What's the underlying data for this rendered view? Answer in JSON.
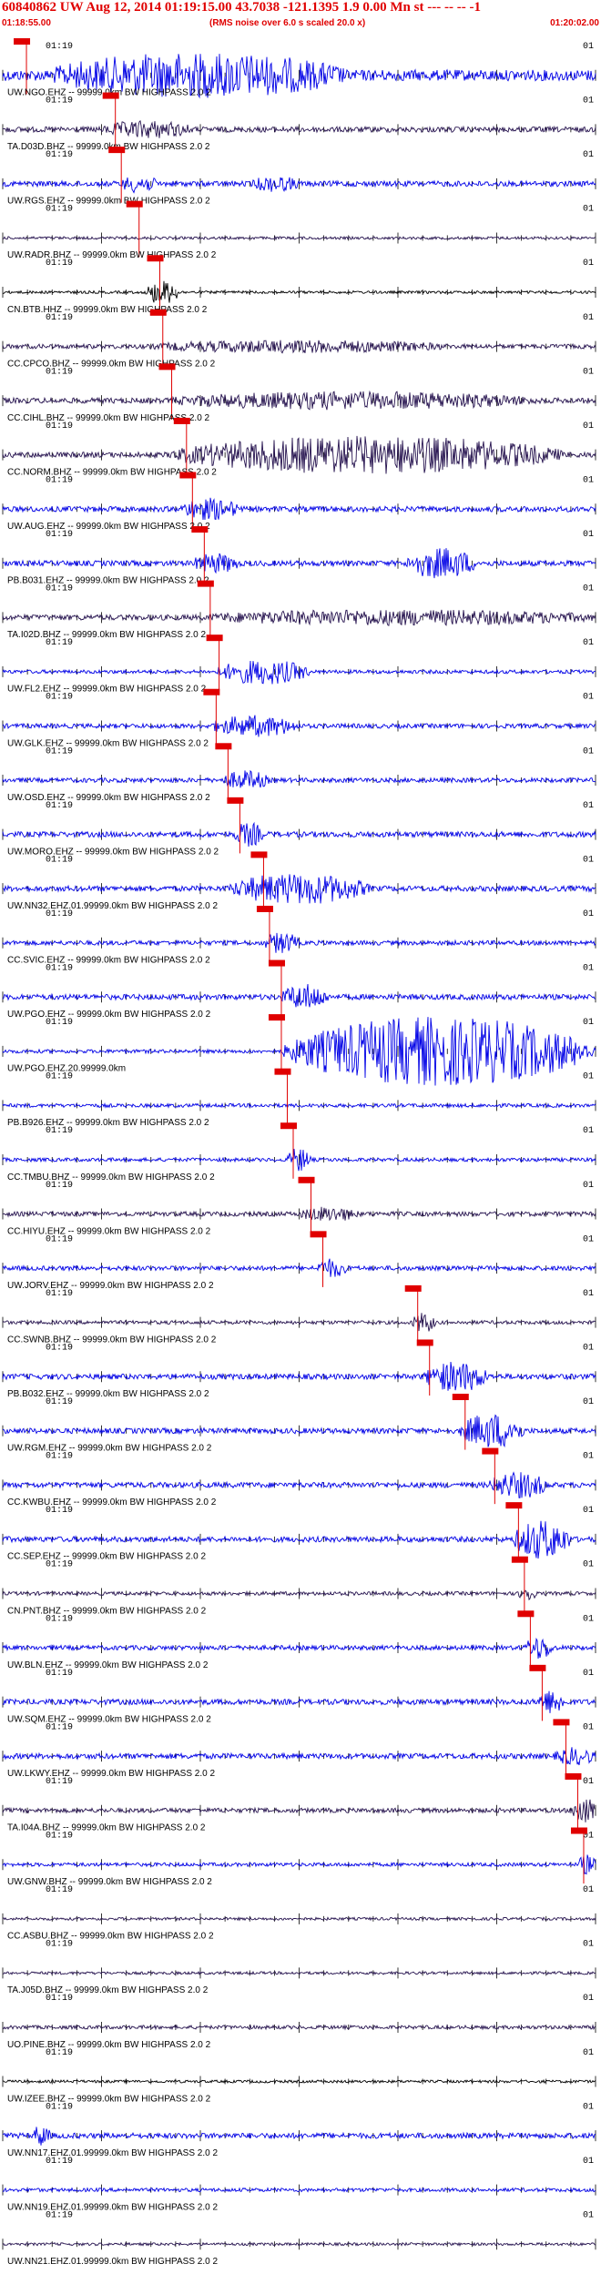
{
  "header": {
    "title": "60840862 UW Aug 12, 2014 01:19:15.00   43.7038 -121.1395  1.9 0.00 Mn st --- -- --  -1",
    "start_time": "01:18:55.00",
    "note": "(RMS noise over 6.0 s scaled 20.0 x)",
    "end_time": "01:20:02.00"
  },
  "colors": {
    "trace_blue": "#0000e6",
    "trace_navy": "#26134f",
    "trace_black": "#000000",
    "pick_red": "#e00000"
  },
  "chart_data": {
    "type": "line",
    "title": "60840862 UW Aug 12, 2014 01:19:15.00   43.7038 -121.1395  1.9 0.00 Mn st --- -- --  -1",
    "x_start": "01:18:55.00",
    "x_end": "01:20:02.00",
    "tick_minute_label": "01:19",
    "edge_label": "01",
    "pick_label": "P",
    "series": [
      {
        "name": "UW.NGO.EHZ -- 99999.0km BW  HIGHPASS  2.0  2",
        "color": "blue",
        "amp": 6,
        "pick": 0.04,
        "events": [
          [
            0.08,
            0.58,
            1.6
          ]
        ]
      },
      {
        "name": "TA.D03D.BHZ -- 99999.0km BW  HIGHPASS  2.0  2",
        "color": "navy",
        "amp": 3,
        "pick": 0.19,
        "events": [
          [
            0.17,
            0.32,
            0.6
          ]
        ]
      },
      {
        "name": "UW.RGS.EHZ -- 99999.0km BW  HIGHPASS  2.0  2",
        "color": "blue",
        "amp": 3,
        "pick": 0.2,
        "events": [
          [
            0.2,
            0.26,
            0.6
          ],
          [
            0.42,
            0.5,
            0.5
          ]
        ]
      },
      {
        "name": "UW.RADR.BHZ -- 99999.0km BW  HIGHPASS  2.0  2",
        "color": "navy",
        "amp": 1.5,
        "pick": 0.23,
        "events": []
      },
      {
        "name": "CN.BTB.HHZ -- 99999.0km BW  HIGHPASS  2.0  2",
        "color": "black",
        "amp": 1.5,
        "pick": 0.265,
        "events": [
          [
            0.24,
            0.3,
            1.0
          ]
        ]
      },
      {
        "name": "CC.CPCO.BHZ -- 99999.0km BW  HIGHPASS  2.0  2",
        "color": "navy",
        "amp": 2.5,
        "pick": 0.27,
        "events": [
          [
            0.25,
            0.75,
            0.4
          ]
        ]
      },
      {
        "name": "CC.CIHL.BHZ -- 99999.0km BW  HIGHPASS  2.0  2",
        "color": "navy",
        "amp": 3,
        "pick": 0.285,
        "events": [
          [
            0.28,
            0.9,
            0.6
          ]
        ]
      },
      {
        "name": "CC.NORM.BHZ -- 99999.0km BW  HIGHPASS  2.0  2",
        "color": "navy",
        "amp": 3,
        "pick": 0.31,
        "events": [
          [
            0.28,
            0.95,
            1.5
          ]
        ]
      },
      {
        "name": "UW.AUG.EHZ -- 99999.0km BW  HIGHPASS  2.0  2",
        "color": "blue",
        "amp": 3,
        "pick": 0.32,
        "events": [
          [
            0.3,
            0.4,
            0.8
          ]
        ]
      },
      {
        "name": "PB.B031.EHZ -- 99999.0km BW  HIGHPASS  2.0  2",
        "color": "blue",
        "amp": 3,
        "pick": 0.34,
        "events": [
          [
            0.32,
            0.4,
            0.7
          ],
          [
            0.68,
            0.8,
            1.2
          ]
        ]
      },
      {
        "name": "TA.I02D.BHZ -- 99999.0km BW  HIGHPASS  2.0  2",
        "color": "navy",
        "amp": 3,
        "pick": 0.35,
        "events": [
          [
            0.34,
            1.0,
            0.5
          ]
        ]
      },
      {
        "name": "UW.FL2.EHZ -- 99999.0km BW  HIGHPASS  2.0  2",
        "color": "blue",
        "amp": 2,
        "pick": 0.365,
        "events": [
          [
            0.36,
            0.52,
            1.0
          ]
        ]
      },
      {
        "name": "UW.GLK.EHZ -- 99999.0km BW  HIGHPASS  2.0  2",
        "color": "blue",
        "amp": 2.5,
        "pick": 0.36,
        "events": [
          [
            0.35,
            0.5,
            0.8
          ]
        ]
      },
      {
        "name": "UW.OSD.EHZ -- 99999.0km BW  HIGHPASS  2.0  2",
        "color": "blue",
        "amp": 2.5,
        "pick": 0.38,
        "events": [
          [
            0.37,
            0.45,
            0.7
          ]
        ]
      },
      {
        "name": "UW.MORO.EHZ -- 99999.0km BW  HIGHPASS  2.0  2",
        "color": "blue",
        "amp": 3,
        "pick": 0.4,
        "events": [
          [
            0.39,
            0.44,
            0.9
          ]
        ]
      },
      {
        "name": "UW.NN32.EHZ.01.99999.0km BW  HIGHPASS  2.0  2",
        "color": "blue",
        "amp": 3,
        "pick": 0.44,
        "events": [
          [
            0.38,
            0.62,
            1.2
          ]
        ]
      },
      {
        "name": "CC.SVIC.EHZ -- 99999.0km BW  HIGHPASS  2.0  2",
        "color": "blue",
        "amp": 2.5,
        "pick": 0.45,
        "events": [
          [
            0.44,
            0.5,
            0.8
          ]
        ]
      },
      {
        "name": "UW.PGO.EHZ -- 99999.0km BW  HIGHPASS  2.0  2",
        "color": "blue",
        "amp": 3,
        "pick": 0.47,
        "events": [
          [
            0.47,
            0.55,
            1.0
          ]
        ]
      },
      {
        "name": "UW.PGO.EHZ.20.99999.0km",
        "color": "blue",
        "amp": 2,
        "pick": 0.47,
        "events": [
          [
            0.47,
            1.0,
            3.0
          ]
        ]
      },
      {
        "name": "PB.B926.EHZ -- 99999.0km BW  HIGHPASS  2.0  2",
        "color": "blue",
        "amp": 2,
        "pick": 0.48,
        "events": []
      },
      {
        "name": "CC.TMBU.BHZ -- 99999.0km BW  HIGHPASS  2.0  2",
        "color": "blue",
        "amp": 2,
        "pick": 0.49,
        "events": [
          [
            0.48,
            0.52,
            1.0
          ]
        ]
      },
      {
        "name": "CC.HIYU.EHZ -- 99999.0km BW  HIGHPASS  2.0  2",
        "color": "navy",
        "amp": 2.5,
        "pick": 0.52,
        "events": [
          [
            0.5,
            0.6,
            0.5
          ]
        ]
      },
      {
        "name": "UW.JORV.EHZ -- 99999.0km BW  HIGHPASS  2.0  2",
        "color": "blue",
        "amp": 2.5,
        "pick": 0.54,
        "events": [
          [
            0.53,
            0.58,
            0.7
          ]
        ]
      },
      {
        "name": "CC.SWNB.BHZ -- 99999.0km BW  HIGHPASS  2.0  2",
        "color": "navy",
        "amp": 2,
        "pick": 0.7,
        "events": [
          [
            0.69,
            0.73,
            0.8
          ]
        ]
      },
      {
        "name": "PB.B032.EHZ -- 99999.0km BW  HIGHPASS  2.0  2",
        "color": "blue",
        "amp": 3,
        "pick": 0.72,
        "events": [
          [
            0.71,
            0.82,
            1.2
          ]
        ]
      },
      {
        "name": "UW.RGM.EHZ -- 99999.0km BW  HIGHPASS  2.0  2",
        "color": "blue",
        "amp": 3,
        "pick": 0.78,
        "events": [
          [
            0.77,
            0.88,
            1.4
          ]
        ]
      },
      {
        "name": "CC.KWBU.EHZ -- 99999.0km BW  HIGHPASS  2.0  2",
        "color": "blue",
        "amp": 3,
        "pick": 0.83,
        "events": [
          [
            0.82,
            0.92,
            1.0
          ]
        ]
      },
      {
        "name": "CC.SEP.EHZ -- 99999.0km BW  HIGHPASS  2.0  2",
        "color": "blue",
        "amp": 3,
        "pick": 0.87,
        "events": [
          [
            0.86,
            0.96,
            1.6
          ]
        ]
      },
      {
        "name": "CN.PNT.BHZ -- 99999.0km BW  HIGHPASS  2.0  2",
        "color": "navy",
        "amp": 2,
        "pick": 0.88,
        "events": [
          [
            0.87,
            0.9,
            0.6
          ]
        ]
      },
      {
        "name": "UW.BLN.EHZ -- 99999.0km BW  HIGHPASS  2.0  2",
        "color": "blue",
        "amp": 2.5,
        "pick": 0.89,
        "events": [
          [
            0.88,
            0.93,
            0.9
          ]
        ]
      },
      {
        "name": "UW.SQM.EHZ -- 99999.0km BW  HIGHPASS  2.0  2",
        "color": "blue",
        "amp": 3,
        "pick": 0.91,
        "events": [
          [
            0.9,
            0.95,
            0.9
          ]
        ]
      },
      {
        "name": "UW.LKWY.EHZ -- 99999.0km BW  HIGHPASS  2.0  2",
        "color": "blue",
        "amp": 3,
        "pick": 0.95,
        "events": [
          [
            0.93,
            1.0,
            0.6
          ]
        ]
      },
      {
        "name": "TA.I04A.BHZ -- 99999.0km BW  HIGHPASS  2.0  2",
        "color": "navy",
        "amp": 2.5,
        "pick": 0.97,
        "events": [
          [
            0.96,
            1.0,
            1.2
          ]
        ]
      },
      {
        "name": "UW.GNW.BHZ -- 99999.0km BW  HIGHPASS  2.0  2",
        "color": "blue",
        "amp": 2,
        "pick": 0.98,
        "events": [
          [
            0.97,
            1.0,
            0.8
          ]
        ]
      },
      {
        "name": "CC.ASBU.BHZ -- 99999.0km BW  HIGHPASS  2.0  2",
        "color": "navy",
        "amp": 1.5,
        "pick": null,
        "events": []
      },
      {
        "name": "TA.J05D.BHZ -- 99999.0km BW  HIGHPASS  2.0  2",
        "color": "navy",
        "amp": 1.5,
        "pick": null,
        "events": []
      },
      {
        "name": "UO.PINE.BHZ -- 99999.0km BW  HIGHPASS  2.0  2",
        "color": "navy",
        "amp": 2,
        "pick": null,
        "events": []
      },
      {
        "name": "UW.IZEE.BHZ -- 99999.0km BW  HIGHPASS  2.0  2",
        "color": "black",
        "amp": 1.5,
        "pick": null,
        "events": []
      },
      {
        "name": "UW.NN17.EHZ.01.99999.0km BW  HIGHPASS  2.0  2",
        "color": "blue",
        "amp": 3,
        "pick": null,
        "events": [
          [
            0.05,
            0.08,
            0.8
          ]
        ]
      },
      {
        "name": "UW.NN19.EHZ.01.99999.0km BW  HIGHPASS  2.0  2",
        "color": "blue",
        "amp": 2,
        "pick": null,
        "events": []
      },
      {
        "name": "UW.NN21.EHZ.01.99999.0km BW  HIGHPASS  2.0  2",
        "color": "navy",
        "amp": 1.5,
        "pick": null,
        "events": []
      }
    ]
  }
}
